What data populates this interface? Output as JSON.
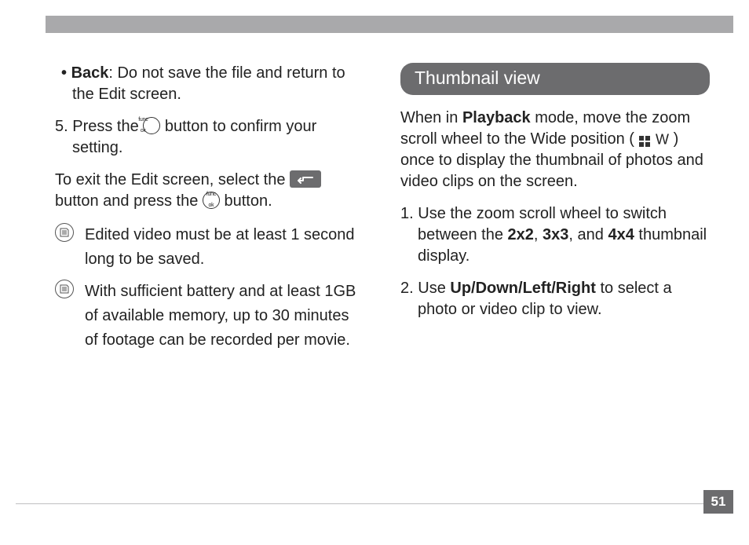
{
  "page_number": "51",
  "left": {
    "back_label": "Back",
    "back_desc": ": Do not save the file and return to the Edit screen.",
    "step5_num": "5.",
    "step5_a": "Press the ",
    "step5_b": " button to confirm your setting.",
    "exit_a": "To exit the Edit screen, select the ",
    "exit_b": " button and press the ",
    "exit_c": " button.",
    "note1": "Edited video must be at least 1 second long to be saved.",
    "note2": "With sufficient battery and at least 1GB of available memory, up to 30 minutes of footage can be recorded per movie."
  },
  "right": {
    "heading": "Thumbnail view",
    "intro_a": "When in ",
    "intro_playback": "Playback",
    "intro_b": " mode, move the zoom scroll wheel to the Wide position ( ",
    "intro_c": " ) once to display the thumbnail of photos and video clips on the screen.",
    "wide_letter": "W",
    "s1_num": "1.",
    "s1_a": "Use the zoom scroll wheel to switch between the ",
    "s1_2x2": "2x2",
    "s1_sep1": ", ",
    "s1_3x3": "3x3",
    "s1_sep2": ", and ",
    "s1_4x4": "4x4",
    "s1_b": " thumbnail display.",
    "s2_num": "2.",
    "s2_a": "Use ",
    "s2_dirs": "Up/Down/Left/Right",
    "s2_b": " to select a photo or video clip to view."
  },
  "icons": {
    "func_top": "func",
    "func_bot": "ok"
  }
}
